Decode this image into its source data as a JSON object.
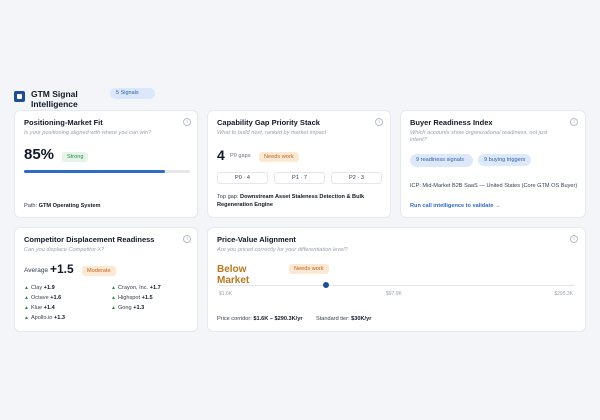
{
  "header": {
    "title": "GTM Signal Intelligence",
    "signals_badge": "5 Signals"
  },
  "positioning": {
    "title": "Positioning-Market Fit",
    "subtitle": "Is your positioning aligned with where you can win?",
    "score": "85%",
    "status": "Strong",
    "progress": 0.85,
    "path_label": "Path:",
    "path_value": "GTM Operating System"
  },
  "capability": {
    "title": "Capability Gap Priority Stack",
    "subtitle": "What to build next, ranked by market impact",
    "count": "4",
    "count_label": "P0 gaps",
    "status": "Needs work",
    "chips": [
      "P0 · 4",
      "P1 · 7",
      "P2 · 3"
    ],
    "top_gap_label": "Top gap:",
    "top_gap_value": "Downstream Asset Staleness Detection & Bulk Regeneration Engine"
  },
  "buyer": {
    "title": "Buyer Readiness Index",
    "subtitle": "Which accounts show organizational readiness, not just intent?",
    "badges": [
      "9 readiness signals",
      "9 buying triggers"
    ],
    "icp_text": "ICP: Mid-Market B2B SaaS — United States (Core GTM OS Buyer)",
    "link": "Run call intelligence to validate →"
  },
  "competitor": {
    "title": "Competitor Displacement Readiness",
    "subtitle": "Can you displace Competitor X?",
    "average_label": "Average",
    "average_value": "+1.5",
    "status": "Moderate",
    "competitors": [
      {
        "name": "Clay",
        "score": "+1.9"
      },
      {
        "name": "Crayon, Inc.",
        "score": "+1.7"
      },
      {
        "name": "Octave",
        "score": "+1.6"
      },
      {
        "name": "Highspot",
        "score": "+1.5"
      },
      {
        "name": "Klue",
        "score": "+1.4"
      },
      {
        "name": "Gong",
        "score": "+1.3"
      },
      {
        "name": "Apollo.io",
        "score": "+1.3"
      }
    ]
  },
  "price": {
    "title": "Price-Value Alignment",
    "subtitle": "Are you priced correctly for your differentiation level?",
    "verdict": "Below Market",
    "status": "Needs work",
    "slider_position": 0.3,
    "ticks": [
      "$1.6K",
      "$97.9K",
      "$295.3K"
    ],
    "corridor_label": "Price corridor:",
    "corridor_value": "$1.6K – $290.3K/yr",
    "standard_label": "Standard tier:",
    "standard_value": "$30K/yr"
  },
  "colors": {
    "accent": "#1d4f91",
    "progress": "#2f6bc2",
    "good": "#2f8a4a",
    "warn": "#c0641c",
    "verdict": "#b9781f"
  }
}
